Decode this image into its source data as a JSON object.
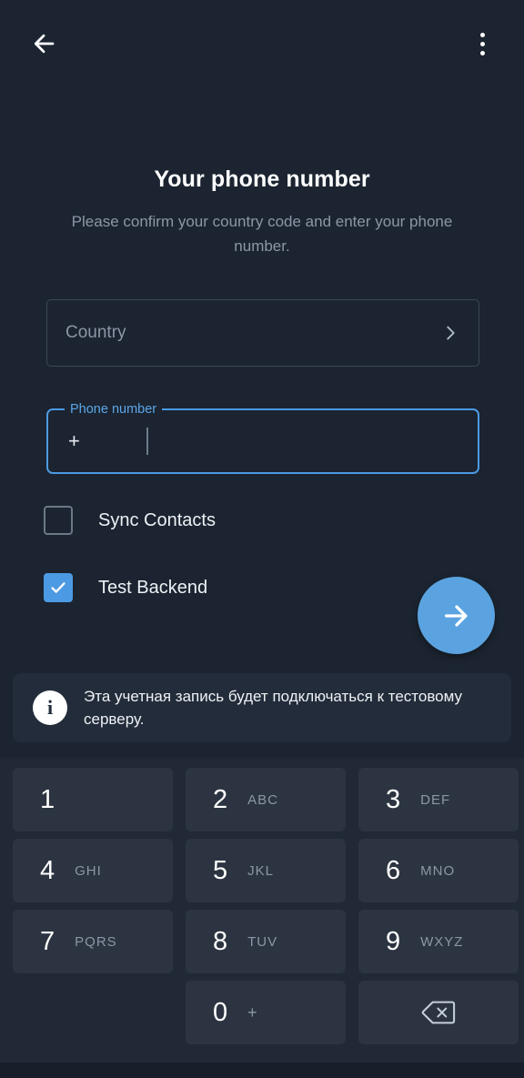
{
  "appbar": {
    "back_icon": "arrow-left-icon",
    "overflow_icon": "more-vertical-icon"
  },
  "header": {
    "title": "Your phone number",
    "subtitle": "Please confirm your country code and enter your phone number."
  },
  "country": {
    "placeholder": "Country",
    "value": "",
    "chevron_icon": "chevron-right-icon"
  },
  "phone": {
    "label": "Phone number",
    "prefix": "+",
    "value": ""
  },
  "options": [
    {
      "label": "Sync Contacts",
      "checked": false
    },
    {
      "label": "Test Backend",
      "checked": true
    }
  ],
  "fab": {
    "icon": "arrow-right-icon",
    "color": "#5ba3e0"
  },
  "banner": {
    "icon": "info-icon",
    "icon_glyph": "i",
    "text": "Эта учетная запись будет подключаться к тестовому серверу."
  },
  "keypad": {
    "rows": [
      [
        {
          "digit": "1",
          "sub": ""
        },
        {
          "digit": "2",
          "sub": "ABC"
        },
        {
          "digit": "3",
          "sub": "DEF"
        }
      ],
      [
        {
          "digit": "4",
          "sub": "GHI"
        },
        {
          "digit": "5",
          "sub": "JKL"
        },
        {
          "digit": "6",
          "sub": "MNO"
        }
      ],
      [
        {
          "digit": "7",
          "sub": "PQRS"
        },
        {
          "digit": "8",
          "sub": "TUV"
        },
        {
          "digit": "9",
          "sub": "WXYZ"
        }
      ],
      [
        {
          "digit": "",
          "sub": ""
        },
        {
          "digit": "0",
          "sub": "+"
        },
        {
          "digit": "",
          "sub": "",
          "icon": "backspace-icon"
        }
      ]
    ]
  },
  "colors": {
    "background": "#1b2430",
    "keypad_panel": "#212936",
    "key": "#2b3440",
    "accent": "#4c9ae3",
    "text_primary": "#eef2f6",
    "text_secondary": "#8b97a6",
    "banner_bg": "#232c3a"
  }
}
